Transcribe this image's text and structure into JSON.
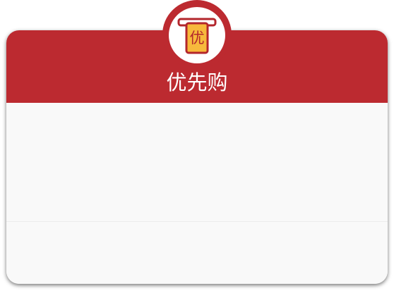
{
  "card": {
    "title": "优先购"
  },
  "badge": {
    "icon_name": "coupon-ticket-icon",
    "glyph": "优"
  },
  "colors": {
    "brand_red": "#bc2a30",
    "ticket_yellow": "#f7b93c",
    "body_background": "#f9f9f9"
  }
}
